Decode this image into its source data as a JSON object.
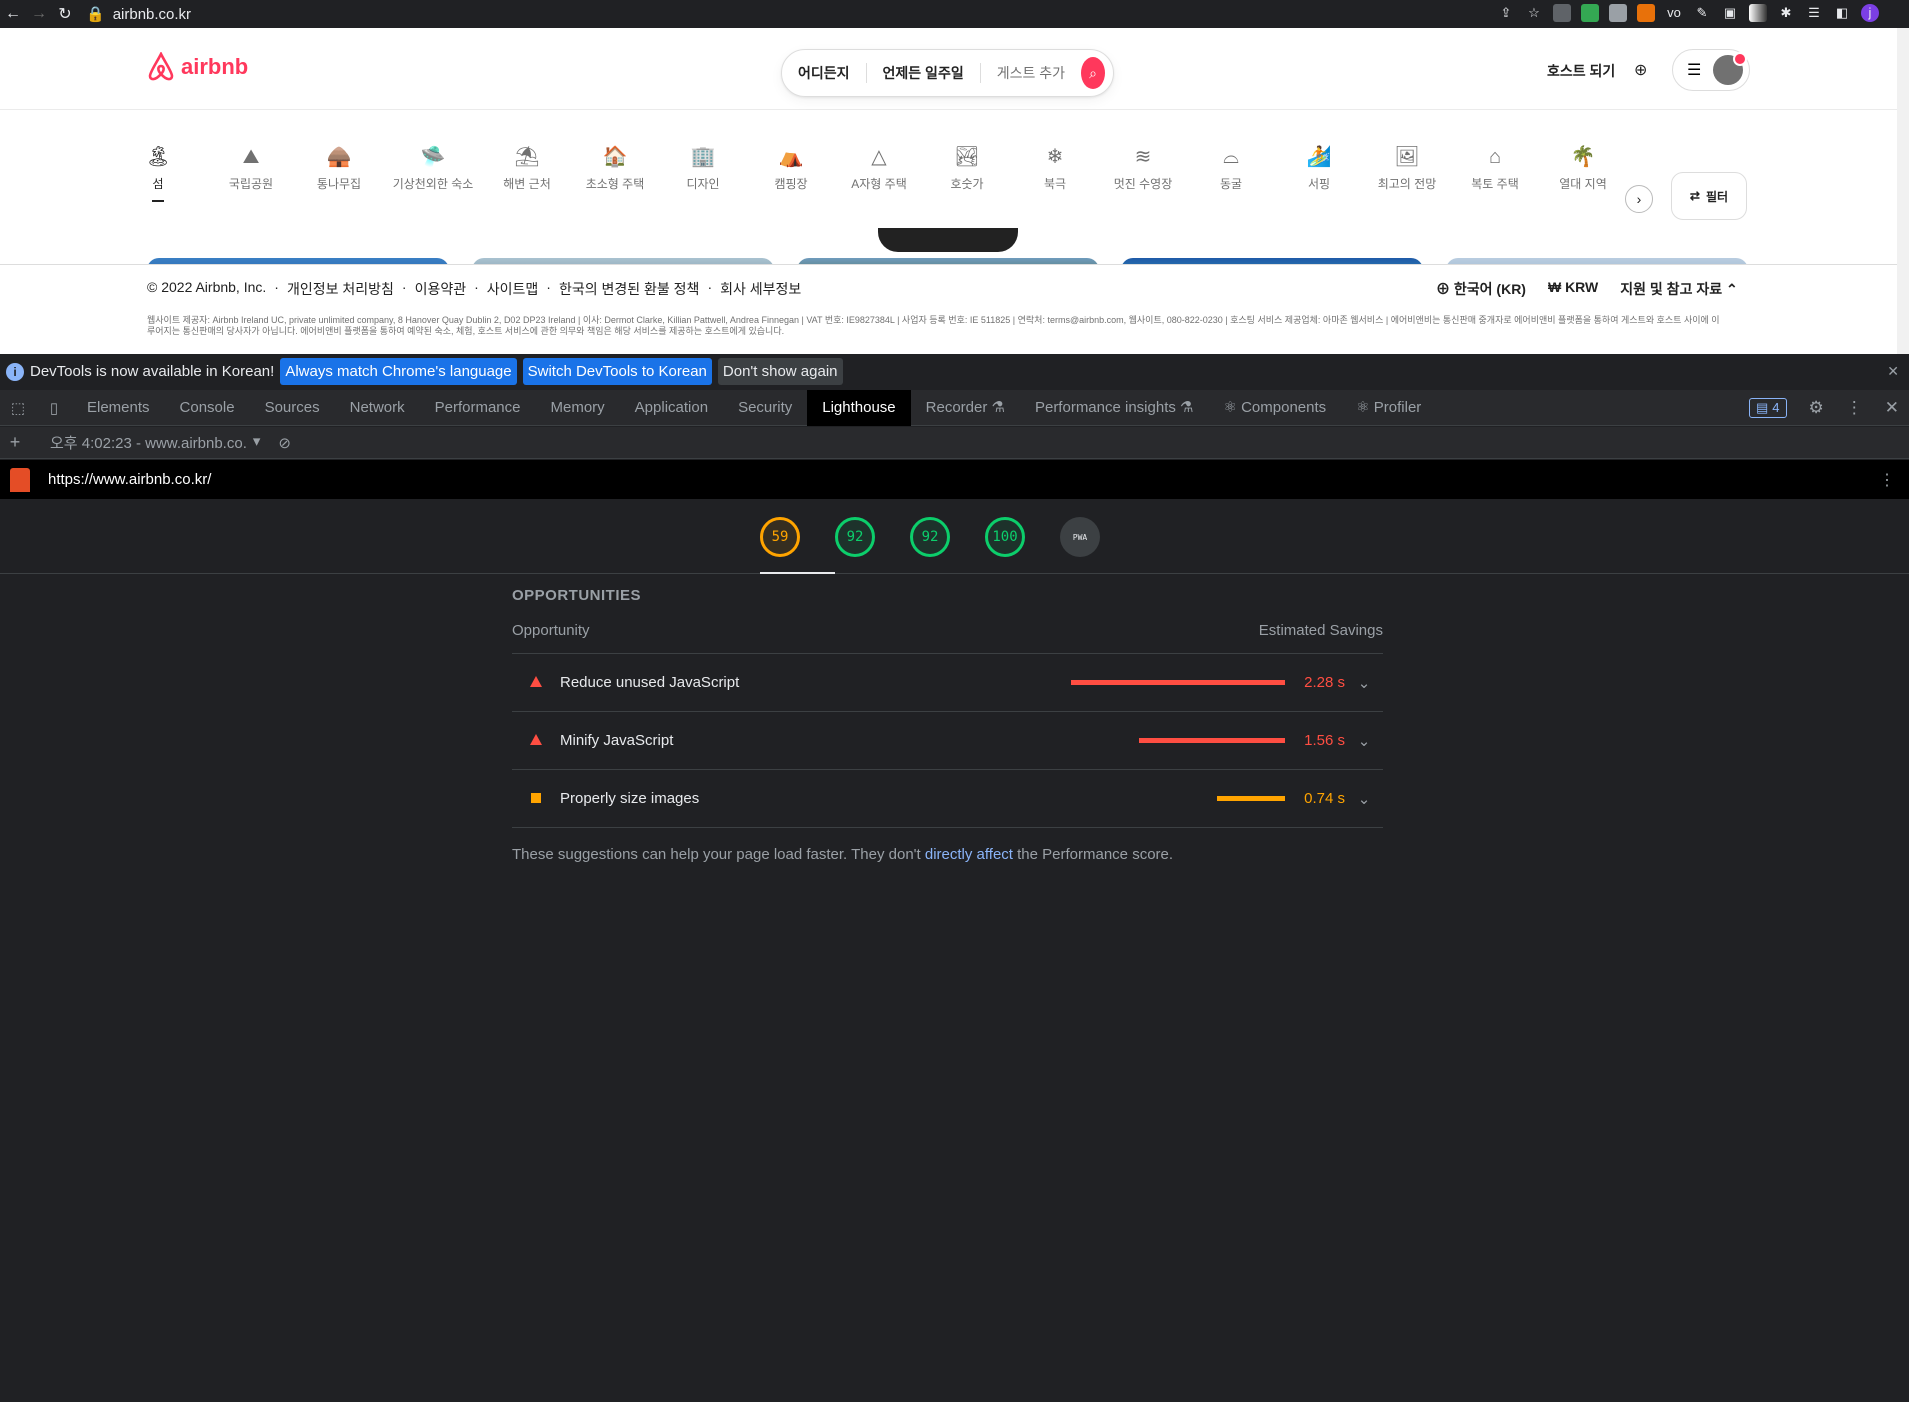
{
  "browser": {
    "url": "airbnb.co.kr"
  },
  "header": {
    "logo_text": "airbnb",
    "search_where": "어디든지",
    "search_when": "언제든 일주일",
    "search_guests": "게스트 추가",
    "host_link": "호스트 되기"
  },
  "categories": [
    {
      "label": "섬",
      "icon": "🏝"
    },
    {
      "label": "국립공원",
      "icon": "⛰"
    },
    {
      "label": "통나무집",
      "icon": "🛖"
    },
    {
      "label": "기상천외한 숙소",
      "icon": "🛸"
    },
    {
      "label": "해변 근처",
      "icon": "⛱"
    },
    {
      "label": "초소형 주택",
      "icon": "🏠"
    },
    {
      "label": "디자인",
      "icon": "🏢"
    },
    {
      "label": "캠핑장",
      "icon": "⛺"
    },
    {
      "label": "A자형 주택",
      "icon": "△"
    },
    {
      "label": "호숫가",
      "icon": "🏞"
    },
    {
      "label": "북극",
      "icon": "❄"
    },
    {
      "label": "멋진 수영장",
      "icon": "≋"
    },
    {
      "label": "동굴",
      "icon": "⌓"
    },
    {
      "label": "서핑",
      "icon": "🏄"
    },
    {
      "label": "최고의 전망",
      "icon": "🖼"
    },
    {
      "label": "복토 주택",
      "icon": "⌂"
    },
    {
      "label": "열대 지역",
      "icon": "🌴"
    }
  ],
  "filter_label": "필터",
  "footer": {
    "copyright": "© 2022 Airbnb, Inc.",
    "links": [
      "개인정보 처리방침",
      "이용약관",
      "사이트맵",
      "한국의 변경된 환불 정책",
      "회사 세부정보"
    ],
    "language": "한국어 (KR)",
    "currency": "₩  KRW",
    "support": "지원 및 참고 자료",
    "legal": "웹사이트 제공자: Airbnb Ireland UC, private unlimited company, 8 Hanover Quay Dublin 2, D02 DP23 Ireland | 이사: Dermot Clarke, Killian Pattwell, Andrea Finnegan | VAT 번호: IE9827384L | 사업자 등록 번호: IE 511825 | 연락처: terms@airbnb.com, 웹사이트, 080-822-0230 | 호스팅 서비스 제공업체: 아마존 웹서비스 | 에어비앤비는 통신판매 중개자로 에어비앤비 플랫폼을 통하여 게스트와 호스트 사이에 이루어지는 통신판매의 당사자가 아닙니다. 에어비앤비 플랫폼을 통하여 예약된 숙소, 체험, 호스트 서비스에 관한 의무와 책임은 해당 서비스를 제공하는 호스트에게 있습니다."
  },
  "devtools": {
    "banner_text": "DevTools is now available in Korean!",
    "btn_match": "Always match Chrome's language",
    "btn_switch": "Switch DevTools to Korean",
    "btn_dismiss": "Don't show again",
    "tabs": [
      "Elements",
      "Console",
      "Sources",
      "Network",
      "Performance",
      "Memory",
      "Application",
      "Security",
      "Lighthouse",
      "Recorder ⚗",
      "Performance insights ⚗",
      "⚛ Components",
      "⚛ Profiler"
    ],
    "issues_count": "4",
    "report_selector": "오후 4:02:23 - www.airbnb.co.",
    "report_url": "https://www.airbnb.co.kr/"
  },
  "scores": [
    {
      "value": "59",
      "status": "orange"
    },
    {
      "value": "92",
      "status": "green"
    },
    {
      "value": "92",
      "status": "green"
    },
    {
      "value": "100",
      "status": "green"
    },
    {
      "value": "PWA",
      "status": "pwa"
    }
  ],
  "opportunities": {
    "title": "OPPORTUNITIES",
    "col_opportunity": "Opportunity",
    "col_savings": "Estimated Savings",
    "items": [
      {
        "label": "Reduce unused JavaScript",
        "savings": "2.28 s",
        "severity": "fail",
        "color": "#ff4e42",
        "fraction": 1.0
      },
      {
        "label": "Minify JavaScript",
        "savings": "1.56 s",
        "severity": "fail",
        "color": "#ff4e42",
        "fraction": 0.68
      },
      {
        "label": "Properly size images",
        "savings": "0.74 s",
        "severity": "average",
        "color": "#ffa400",
        "fraction": 0.32
      }
    ],
    "footnote_pre": "These suggestions can help your page load faster. They don't ",
    "footnote_link": "directly affect",
    "footnote_post": " the Performance score."
  }
}
